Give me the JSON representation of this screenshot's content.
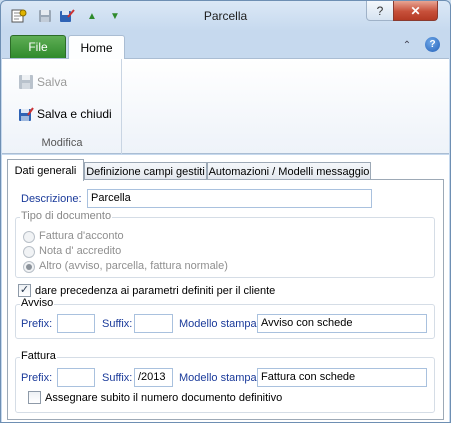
{
  "window": {
    "title": "Parcella",
    "help_glyph": "?",
    "close_glyph": "✕"
  },
  "quick_access": [
    {
      "name": "app-icon"
    },
    {
      "name": "save-icon"
    },
    {
      "name": "save-close-icon"
    },
    {
      "name": "up-arrow-icon",
      "glyph": "▲"
    },
    {
      "name": "down-arrow-icon",
      "glyph": "▼"
    }
  ],
  "ribbon": {
    "tabs": [
      {
        "label": "File"
      },
      {
        "label": "Home"
      }
    ],
    "collapse_glyph": "⌃",
    "help_glyph": "?",
    "group": {
      "label": "Modifica",
      "buttons": [
        {
          "label": "Salva",
          "enabled": false
        },
        {
          "label": "Salva e chiudi",
          "enabled": true
        }
      ]
    }
  },
  "content_tabs": [
    {
      "label": "Dati generali",
      "active": true
    },
    {
      "label": "Definizione campi gestiti",
      "active": false
    },
    {
      "label": "Automazioni / Modelli messaggio",
      "active": false
    }
  ],
  "form": {
    "descrizione": {
      "label": "Descrizione:",
      "value": "Parcella"
    },
    "tipo_documento": {
      "title": "Tipo di documento",
      "options": [
        {
          "label": "Fattura d'acconto",
          "checked": false
        },
        {
          "label": "Nota d' accredito",
          "checked": false
        },
        {
          "label": "Altro (avviso, parcella, fattura normale)",
          "checked": true
        }
      ]
    },
    "precedenza": {
      "label": "dare precedenza ai parametri definiti per il cliente",
      "checked": true,
      "check_glyph": "✓"
    },
    "avviso": {
      "title": "Avviso",
      "prefix_label": "Prefix:",
      "prefix_value": "",
      "suffix_label": "Suffix:",
      "suffix_value": "",
      "modello_label": "Modello stampa:",
      "modello_value": "Avviso con schede"
    },
    "fattura": {
      "title": "Fattura",
      "prefix_label": "Prefix:",
      "prefix_value": "",
      "suffix_label": "Suffix:",
      "suffix_value": "/2013",
      "modello_label": "Modello stampa:",
      "modello_value": "Fattura con schede",
      "assegnare": {
        "label": "Assegnare subito il numero documento definitivo",
        "checked": false
      }
    }
  },
  "colors": {
    "accent_file": "#3a9a34",
    "close_red": "#c7503a",
    "label_blue": "#1a3a9a"
  }
}
